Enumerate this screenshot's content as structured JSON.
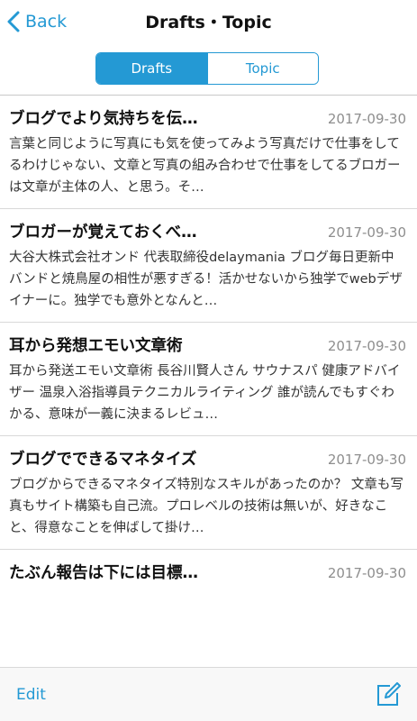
{
  "navbar": {
    "back_label": "Back",
    "title": "Drafts・Topic"
  },
  "segmented": {
    "drafts_label": "Drafts",
    "topic_label": "Topic",
    "selected": "Drafts"
  },
  "list": {
    "items": [
      {
        "title": "ブログでより気持ちを伝…",
        "date": "2017-09-30",
        "body": "言葉と同じように写真にも気を使ってみよう写真だけで仕事をしてるわけじゃない、文章と写真の組み合わせで仕事をしてるブロガーは文章が主体の人、と思う。そ…"
      },
      {
        "title": "ブロガーが覚えておくべ…",
        "date": "2017-09-30",
        "body": "大谷大株式会社オンド 代表取締役delaymania ブログ毎日更新中 バンドと焼鳥屋の相性が悪すぎる！活かせないから独学でwebデザイナーに。独学でも意外となんと…"
      },
      {
        "title": "耳から発想エモい文章術",
        "date": "2017-09-30",
        "body": "耳から発送エモい文章術 長谷川賢人さん サウナスパ 健康アドバイザー 温泉入浴指導員テクニカルライティング 誰が読んでもすぐわかる、意味が一義に決まるレビュ…"
      },
      {
        "title": "ブログでできるマネタイズ",
        "date": "2017-09-30",
        "body": "ブログからできるマネタイズ特別なスキルがあったのか？ 文章も写真もサイト構築も自己流。プロレベルの技術は無いが、好きなこと、得意なことを伸ばして掛け…"
      },
      {
        "title": "たぶん報告は下には目標…",
        "date": "2017-09-30",
        "body": ""
      }
    ]
  },
  "toolbar": {
    "edit_label": "Edit"
  },
  "colors": {
    "accent": "#2499d4",
    "date": "#8e8e8e"
  },
  "icons": {
    "back": "chevron-left-icon",
    "compose": "compose-icon"
  }
}
